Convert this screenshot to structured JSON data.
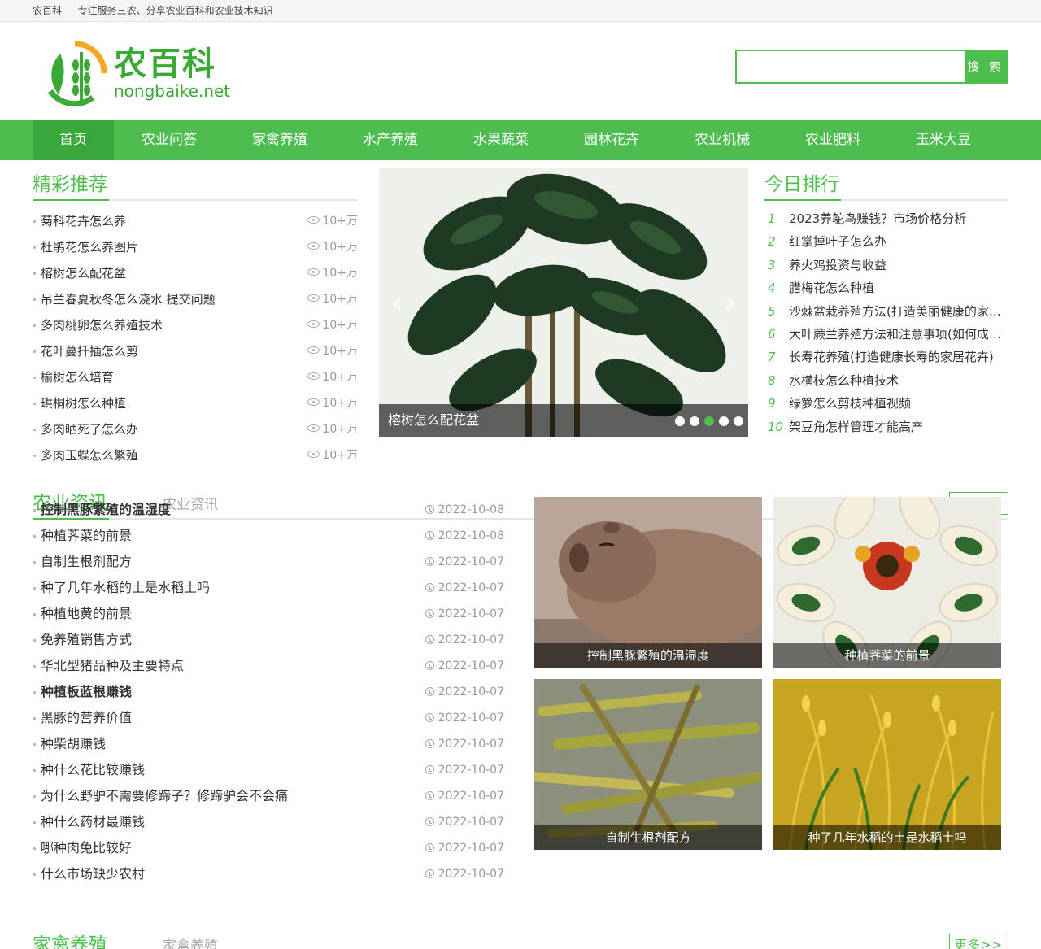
{
  "topbar": {
    "text": "农百科 — 专注服务三农、分享农业百科和农业技术知识"
  },
  "header": {
    "logo_cn": "农百科",
    "logo_en": "nongbaike.net",
    "search_placeholder": "",
    "search_button": "搜 索"
  },
  "nav": {
    "items": [
      "首页",
      "农业问答",
      "家禽养殖",
      "水产养殖",
      "水果蔬菜",
      "园林花卉",
      "农业机械",
      "农业肥料",
      "玉米大豆"
    ]
  },
  "recommend": {
    "title": "精彩推荐",
    "items": [
      {
        "title": "菊科花卉怎么养",
        "views": "10+万"
      },
      {
        "title": "杜鹃花怎么养图片",
        "views": "10+万"
      },
      {
        "title": "榕树怎么配花盆",
        "views": "10+万"
      },
      {
        "title": "吊兰春夏秋冬怎么浇水 提交问题",
        "views": "10+万"
      },
      {
        "title": "多肉桃卵怎么养殖技术",
        "views": "10+万"
      },
      {
        "title": "花叶蔓扦插怎么剪",
        "views": "10+万"
      },
      {
        "title": "榆树怎么培育",
        "views": "10+万"
      },
      {
        "title": "珙桐树怎么种植",
        "views": "10+万"
      },
      {
        "title": "多肉晒死了怎么办",
        "views": "10+万"
      },
      {
        "title": "多肉玉蝶怎么繁殖",
        "views": "10+万"
      }
    ]
  },
  "slider": {
    "caption": "榕树怎么配花盆",
    "arrow_left": "‹",
    "arrow_right": "›"
  },
  "ranking": {
    "title": "今日排行",
    "items": [
      {
        "n": "1",
        "title": "2023养鸵鸟赚钱？市场价格分析"
      },
      {
        "n": "2",
        "title": "红掌掉叶子怎么办"
      },
      {
        "n": "3",
        "title": "养火鸡投资与收益"
      },
      {
        "n": "4",
        "title": "腊梅花怎么种植"
      },
      {
        "n": "5",
        "title": "沙棘盆栽养殖方法(打造美丽健康的家居绿植)"
      },
      {
        "n": "6",
        "title": "大叶蕨兰养殖方法和注意事项(如何成功养护)"
      },
      {
        "n": "7",
        "title": "长寿花养殖(打造健康长寿的家居花卉)"
      },
      {
        "n": "8",
        "title": "水横枝怎么种植技术"
      },
      {
        "n": "9",
        "title": "绿箩怎么剪枝种植视频"
      },
      {
        "n": "10",
        "title": "架豆角怎样管理才能高产"
      }
    ]
  },
  "news": {
    "title": "农业资讯",
    "sub": "农业资讯",
    "more": "更多>>",
    "items": [
      {
        "title": "控制黑豚繁殖的温湿度",
        "date": "2022-10-08",
        "bold": true
      },
      {
        "title": "种植荠菜的前景",
        "date": "2022-10-08",
        "bold": false
      },
      {
        "title": "自制生根剂配方",
        "date": "2022-10-07",
        "bold": false
      },
      {
        "title": "种了几年水稻的土是水稻土吗",
        "date": "2022-10-07",
        "bold": false
      },
      {
        "title": "种植地黄的前景",
        "date": "2022-10-07",
        "bold": false
      },
      {
        "title": "免养殖销售方式",
        "date": "2022-10-07",
        "bold": false
      },
      {
        "title": "华北型猪品种及主要特点",
        "date": "2022-10-07",
        "bold": false
      },
      {
        "title": "种植板蓝根赚钱",
        "date": "2022-10-07",
        "bold": true
      },
      {
        "title": "黑豚的营养价值",
        "date": "2022-10-07",
        "bold": false
      },
      {
        "title": "种柴胡赚钱",
        "date": "2022-10-07",
        "bold": false
      },
      {
        "title": "种什么花比较赚钱",
        "date": "2022-10-07",
        "bold": false
      },
      {
        "title": "为什么野驴不需要修蹄子？修蹄驴会不会痛",
        "date": "2022-10-07",
        "bold": false
      },
      {
        "title": "种什么药材最赚钱",
        "date": "2022-10-07",
        "bold": false
      },
      {
        "title": "哪种肉兔比较好",
        "date": "2022-10-07",
        "bold": false
      },
      {
        "title": "什么市场缺少农村",
        "date": "2022-10-07",
        "bold": false
      }
    ],
    "tiles": [
      {
        "caption": "控制黑豚繁殖的温湿度"
      },
      {
        "caption": "种植荠菜的前景"
      },
      {
        "caption": "自制生根剂配方"
      },
      {
        "caption": "种了几年水稻的土是水稻土吗"
      }
    ]
  },
  "poultry": {
    "title": "家禽养殖",
    "sub": "家禽养殖",
    "more": "更多>>"
  }
}
